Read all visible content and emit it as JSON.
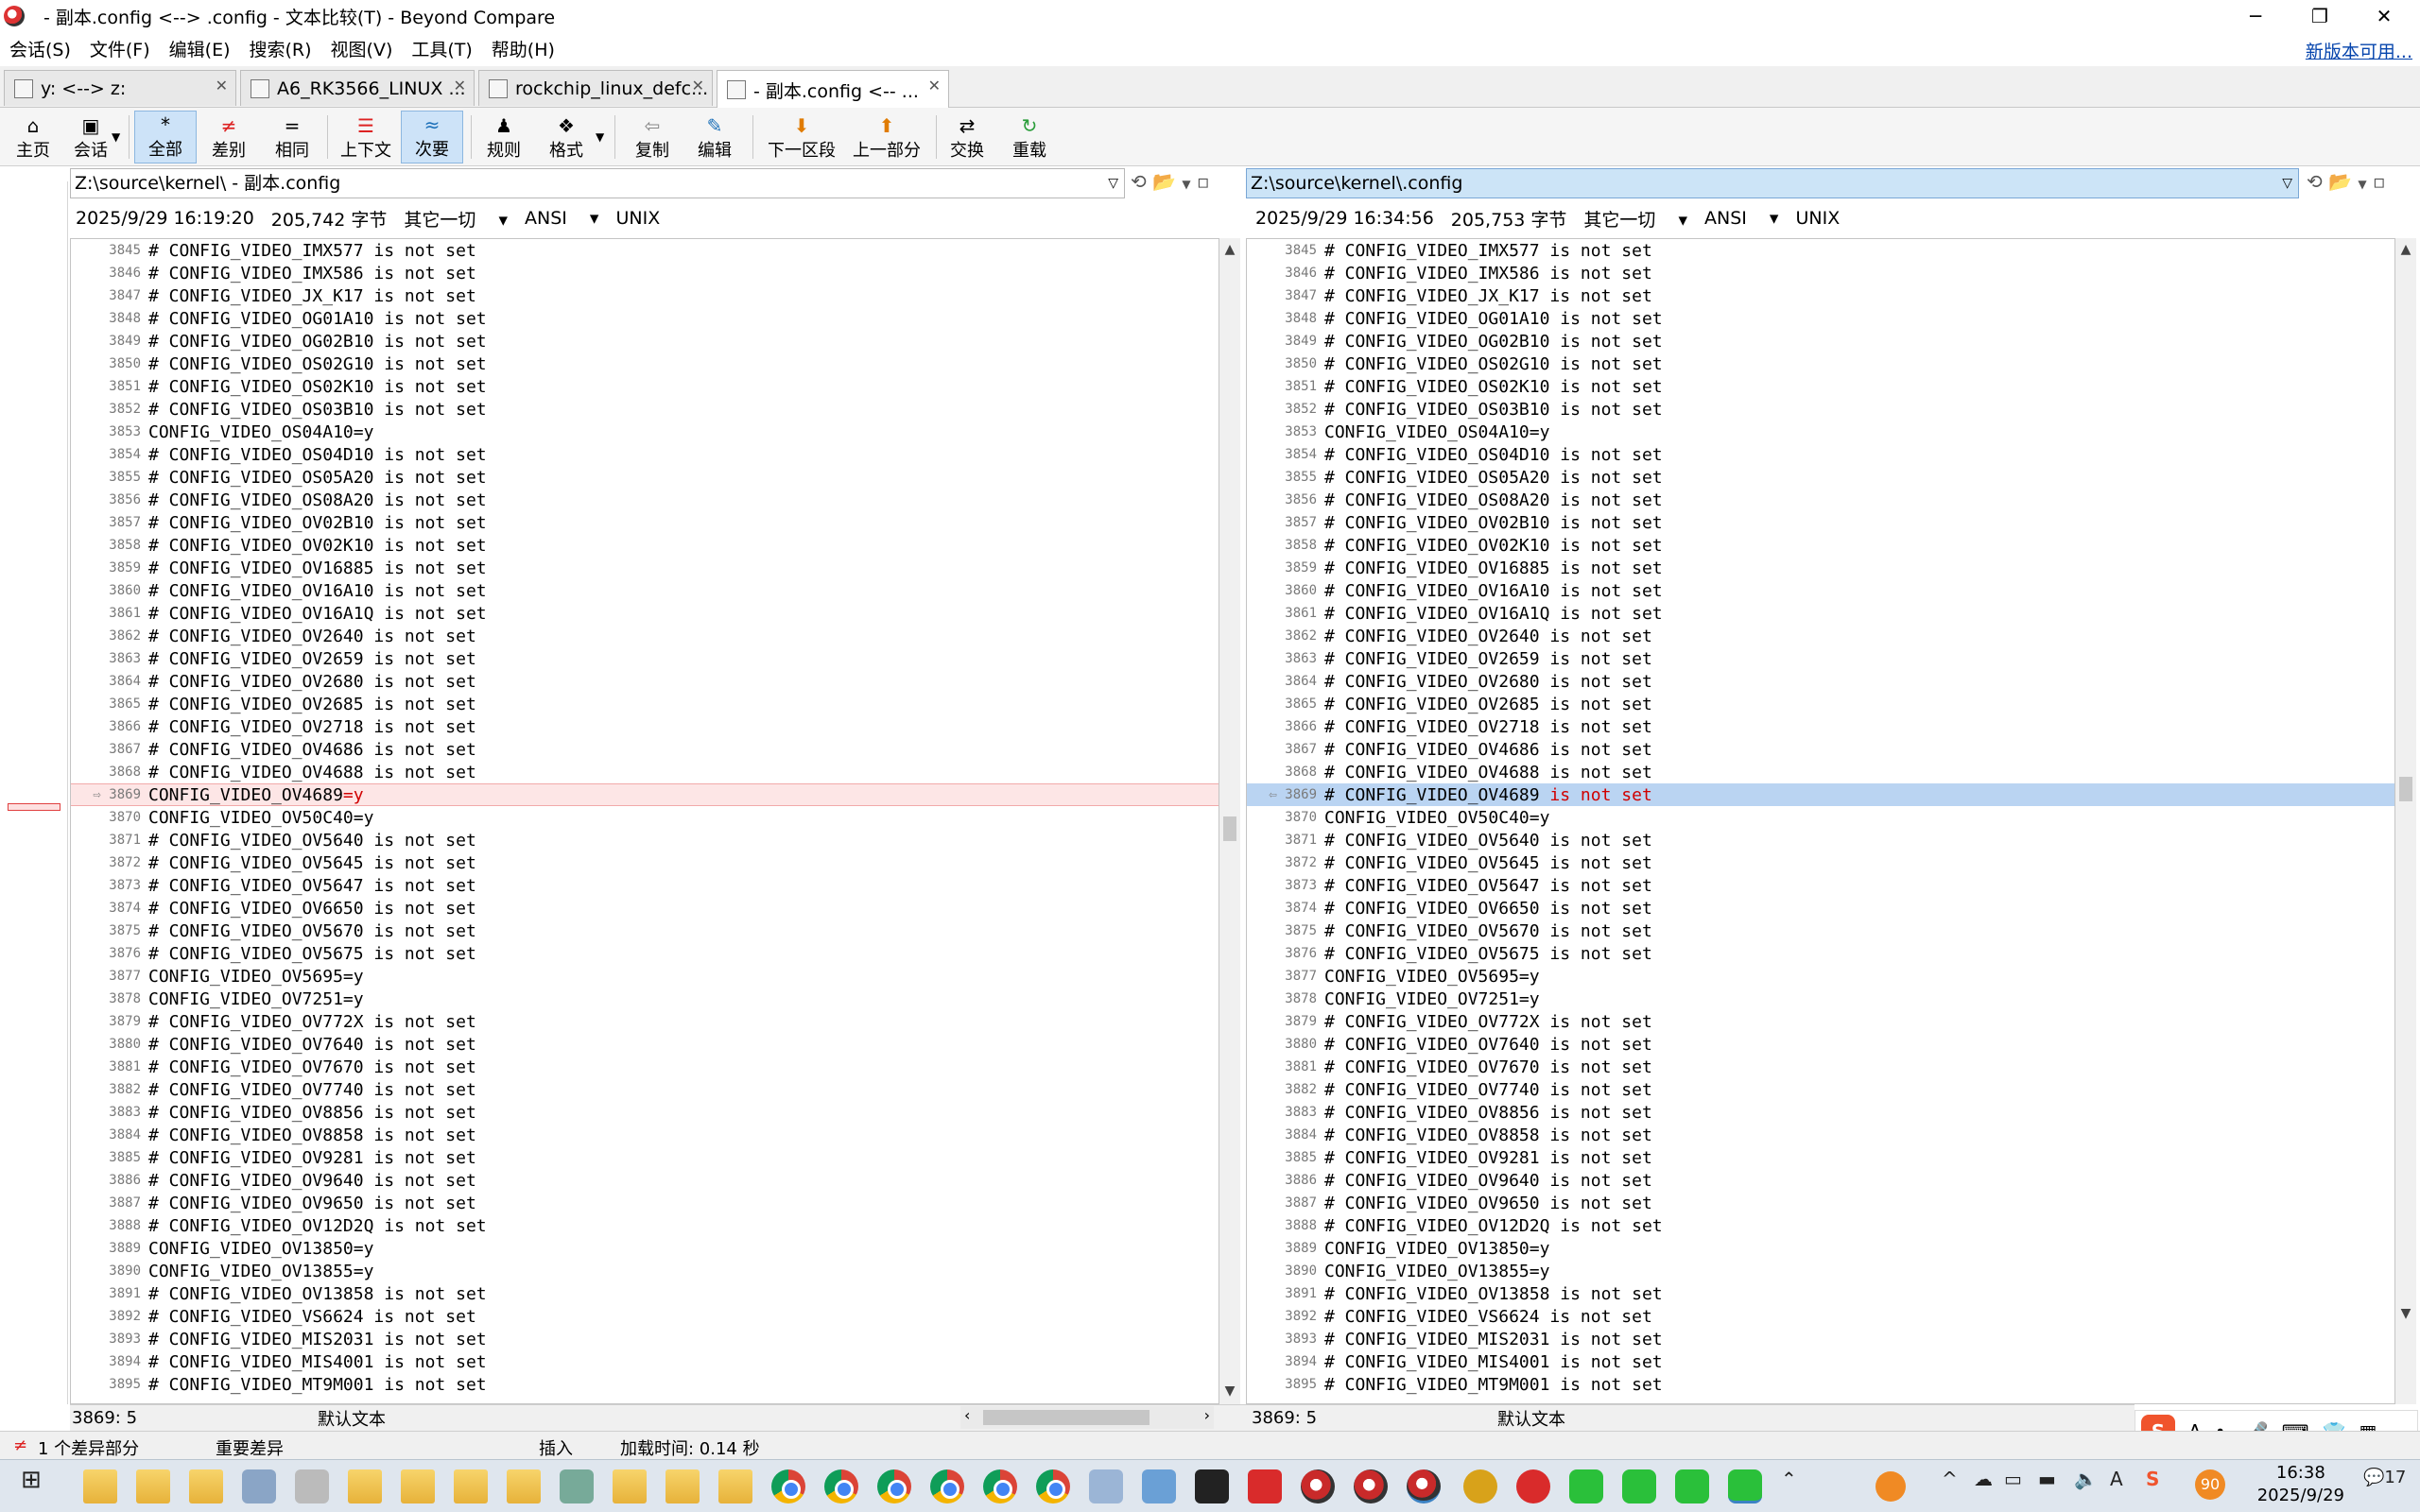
{
  "window": {
    "title": "- 副本.config <--> .config - 文本比较(T) - Beyond Compare",
    "minimize": "─",
    "restore": "❐",
    "close": "✕"
  },
  "menu": {
    "items": [
      "会话(S)",
      "文件(F)",
      "编辑(E)",
      "搜索(R)",
      "视图(V)",
      "工具(T)",
      "帮助(H)"
    ],
    "new_version": "新版本可用..."
  },
  "tabs": [
    {
      "label": "y: <--> z:"
    },
    {
      "label": "A6_RK3566_LINUX ..."
    },
    {
      "label": "rockchip_linux_defc..."
    },
    {
      "label": "- 副本.config <-- ..."
    }
  ],
  "toolbar": {
    "home": "主页",
    "session": "会话",
    "all": "全部",
    "diffs": "差别",
    "same": "相同",
    "context": "上下文",
    "minor": "次要",
    "rules": "规则",
    "format": "格式",
    "copy": "复制",
    "edit": "编辑",
    "next_section": "下一区段",
    "prev_section": "上一部分",
    "swap": "交换",
    "reload": "重载"
  },
  "left": {
    "path": "Z:\\source\\kernel\\ - 副本.config",
    "date": "2025/9/29 16:19:20",
    "size": "205,742 字节",
    "eol_filter": "其它一切",
    "encoding": "ANSI",
    "line_ending": "UNIX",
    "cursor": "3869: 5",
    "text_type": "默认文本"
  },
  "right": {
    "path": "Z:\\source\\kernel\\.config",
    "date": "2025/9/29 16:34:56",
    "size": "205,753 字节",
    "eol_filter": "其它一切",
    "encoding": "ANSI",
    "line_ending": "UNIX",
    "cursor": "3869: 5",
    "text_type": "默认文本"
  },
  "lines": [
    {
      "n": "3845",
      "t": "# CONFIG_VIDEO_IMX577 is not set"
    },
    {
      "n": "3846",
      "t": "# CONFIG_VIDEO_IMX586 is not set"
    },
    {
      "n": "3847",
      "t": "# CONFIG_VIDEO_JX_K17 is not set"
    },
    {
      "n": "3848",
      "t": "# CONFIG_VIDEO_OG01A10 is not set"
    },
    {
      "n": "3849",
      "t": "# CONFIG_VIDEO_OG02B10 is not set"
    },
    {
      "n": "3850",
      "t": "# CONFIG_VIDEO_OS02G10 is not set"
    },
    {
      "n": "3851",
      "t": "# CONFIG_VIDEO_OS02K10 is not set"
    },
    {
      "n": "3852",
      "t": "# CONFIG_VIDEO_OS03B10 is not set"
    },
    {
      "n": "3853",
      "t": "CONFIG_VIDEO_OS04A10=y"
    },
    {
      "n": "3854",
      "t": "# CONFIG_VIDEO_OS04D10 is not set"
    },
    {
      "n": "3855",
      "t": "# CONFIG_VIDEO_OS05A20 is not set"
    },
    {
      "n": "3856",
      "t": "# CONFIG_VIDEO_OS08A20 is not set"
    },
    {
      "n": "3857",
      "t": "# CONFIG_VIDEO_OV02B10 is not set"
    },
    {
      "n": "3858",
      "t": "# CONFIG_VIDEO_OV02K10 is not set"
    },
    {
      "n": "3859",
      "t": "# CONFIG_VIDEO_OV16885 is not set"
    },
    {
      "n": "3860",
      "t": "# CONFIG_VIDEO_OV16A10 is not set"
    },
    {
      "n": "3861",
      "t": "# CONFIG_VIDEO_OV16A1Q is not set"
    },
    {
      "n": "3862",
      "t": "# CONFIG_VIDEO_OV2640 is not set"
    },
    {
      "n": "3863",
      "t": "# CONFIG_VIDEO_OV2659 is not set"
    },
    {
      "n": "3864",
      "t": "# CONFIG_VIDEO_OV2680 is not set"
    },
    {
      "n": "3865",
      "t": "# CONFIG_VIDEO_OV2685 is not set"
    },
    {
      "n": "3866",
      "t": "# CONFIG_VIDEO_OV2718 is not set"
    },
    {
      "n": "3867",
      "t": "# CONFIG_VIDEO_OV4686 is not set"
    },
    {
      "n": "3868",
      "t": "# CONFIG_VIDEO_OV4688 is not set"
    },
    {
      "n": "3869",
      "t": "",
      "diff": true
    },
    {
      "n": "3870",
      "t": "CONFIG_VIDEO_OV50C40=y"
    },
    {
      "n": "3871",
      "t": "# CONFIG_VIDEO_OV5640 is not set"
    },
    {
      "n": "3872",
      "t": "# CONFIG_VIDEO_OV5645 is not set"
    },
    {
      "n": "3873",
      "t": "# CONFIG_VIDEO_OV5647 is not set"
    },
    {
      "n": "3874",
      "t": "# CONFIG_VIDEO_OV6650 is not set"
    },
    {
      "n": "3875",
      "t": "# CONFIG_VIDEO_OV5670 is not set"
    },
    {
      "n": "3876",
      "t": "# CONFIG_VIDEO_OV5675 is not set"
    },
    {
      "n": "3877",
      "t": "CONFIG_VIDEO_OV5695=y"
    },
    {
      "n": "3878",
      "t": "CONFIG_VIDEO_OV7251=y"
    },
    {
      "n": "3879",
      "t": "# CONFIG_VIDEO_OV772X is not set"
    },
    {
      "n": "3880",
      "t": "# CONFIG_VIDEO_OV7640 is not set"
    },
    {
      "n": "3881",
      "t": "# CONFIG_VIDEO_OV7670 is not set"
    },
    {
      "n": "3882",
      "t": "# CONFIG_VIDEO_OV7740 is not set"
    },
    {
      "n": "3883",
      "t": "# CONFIG_VIDEO_OV8856 is not set"
    },
    {
      "n": "3884",
      "t": "# CONFIG_VIDEO_OV8858 is not set"
    },
    {
      "n": "3885",
      "t": "# CONFIG_VIDEO_OV9281 is not set"
    },
    {
      "n": "3886",
      "t": "# CONFIG_VIDEO_OV9640 is not set"
    },
    {
      "n": "3887",
      "t": "# CONFIG_VIDEO_OV9650 is not set"
    },
    {
      "n": "3888",
      "t": "# CONFIG_VIDEO_OV12D2Q is not set"
    },
    {
      "n": "3889",
      "t": "CONFIG_VIDEO_OV13850=y"
    },
    {
      "n": "3890",
      "t": "CONFIG_VIDEO_OV13855=y"
    },
    {
      "n": "3891",
      "t": "# CONFIG_VIDEO_OV13858 is not set"
    },
    {
      "n": "3892",
      "t": "# CONFIG_VIDEO_VS6624 is not set"
    },
    {
      "n": "3893",
      "t": "# CONFIG_VIDEO_MIS2031 is not set"
    },
    {
      "n": "3894",
      "t": "# CONFIG_VIDEO_MIS4001 is not set"
    },
    {
      "n": "3895",
      "t": "# CONFIG_VIDEO_MT9M001 is not set"
    }
  ],
  "diff_line": {
    "left_prefix": "CONFIG_VIDEO_OV4689",
    "left_diff": "=y",
    "right_prefix": "# CONFIG_VIDEO_OV4689",
    "right_diff": " is not set"
  },
  "status": {
    "diff_count": "1 个差异部分",
    "important": "重要差异",
    "insert": "插入",
    "load_time": "加载时间: 0.14 秒"
  },
  "taskbar": {
    "time": "16:38",
    "date": "2025/9/29",
    "notif_count": "17",
    "badge": "90"
  },
  "colors": {
    "diff_left_bg": "#fde6e6",
    "diff_right_bg": "#bad4f2",
    "diff_text": "#d00000",
    "selected_tool": "#cde3f8"
  }
}
